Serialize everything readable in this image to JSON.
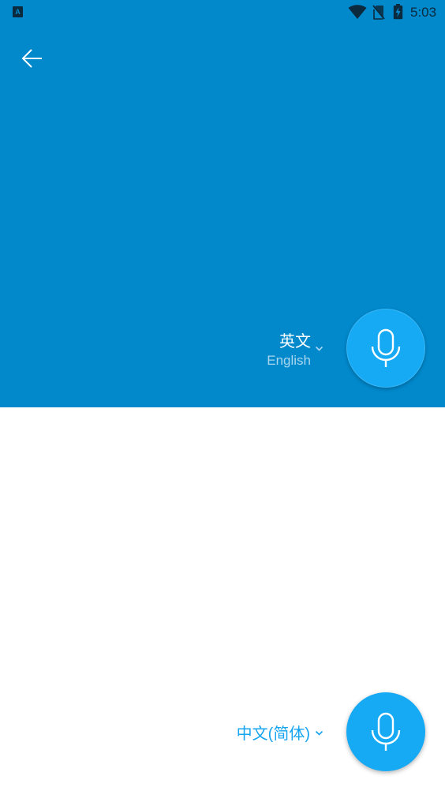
{
  "status_bar": {
    "notification_icon": "a-notification-icon",
    "notification_glyph": "A",
    "wifi_icon": "wifi-icon",
    "sim_icon": "no-sim-icon",
    "battery_icon": "battery-charging-icon",
    "time": "5:03"
  },
  "header": {
    "back_icon": "arrow-left-icon"
  },
  "source": {
    "language_primary": "英文",
    "language_secondary": "English",
    "mic_icon": "microphone-icon"
  },
  "target": {
    "language_primary": "中文(简体)",
    "mic_icon": "microphone-icon"
  },
  "colors": {
    "top_background": "#0189cc",
    "bottom_background": "#ffffff",
    "mic_button": "#16aaf5",
    "target_language_text": "#14a4f0"
  }
}
